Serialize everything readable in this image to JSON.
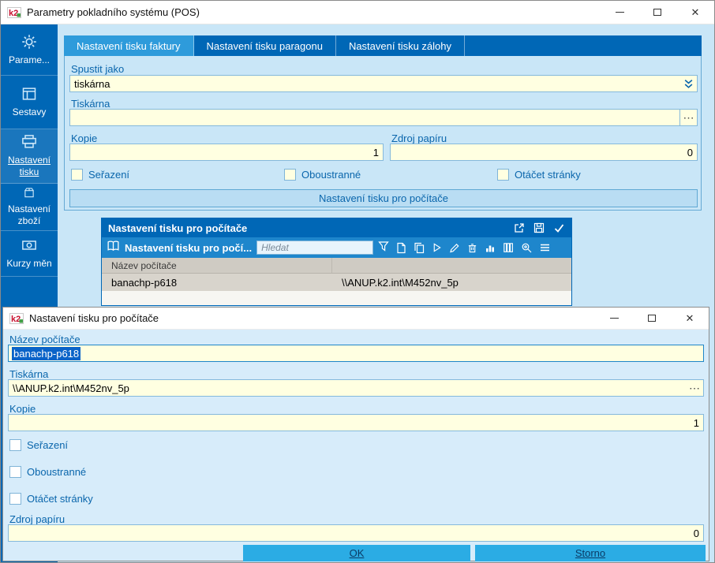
{
  "window": {
    "title": "Parametry pokladního systému (POS)",
    "icon_text": "k2"
  },
  "icons": {
    "close": "✕",
    "ellipsis": "⋯"
  },
  "sidebar": {
    "items": [
      {
        "label": "Parame..."
      },
      {
        "label": "Sestavy"
      },
      {
        "label": "Nastavení tisku",
        "selected": true
      },
      {
        "label": "Nastavení zboží"
      },
      {
        "label": "Kurzy měn"
      }
    ]
  },
  "tabs": [
    {
      "label": "Nastavení tisku faktury",
      "active": true
    },
    {
      "label": "Nastavení tisku paragonu",
      "active": false
    },
    {
      "label": "Nastavení tisku zálohy",
      "active": false
    }
  ],
  "form": {
    "run_as": {
      "label": "Spustit jako",
      "value": "tiskárna"
    },
    "printer": {
      "label": "Tiskárna",
      "value": ""
    },
    "copies": {
      "label": "Kopie",
      "value": "1"
    },
    "paper_source": {
      "label": "Zdroj papíru",
      "value": "0"
    },
    "checkboxes": [
      {
        "label": "Seřazení",
        "checked": false
      },
      {
        "label": "Oboustranné",
        "checked": false
      },
      {
        "label": "Otáčet stránky",
        "checked": false
      }
    ],
    "computers_button": "Nastavení tisku pro počítače"
  },
  "panel": {
    "title": "Nastavení tisku pro počítače",
    "toolbar_title": "Nastavení tisku pro počí...",
    "search_placeholder": "Hledat",
    "table": {
      "columns": [
        "Název počítače"
      ],
      "rows": [
        {
          "computer": "banachp-p618",
          "printer": "\\\\ANUP.k2.int\\M452nv_5p"
        }
      ]
    }
  },
  "dialog": {
    "title": "Nastavení tisku pro počítače",
    "computer_name": {
      "label": "Název počítače",
      "value": "banachp-p618",
      "selected": true
    },
    "printer": {
      "label": "Tiskárna",
      "value": "\\\\ANUP.k2.int\\M452nv_5p"
    },
    "copies": {
      "label": "Kopie",
      "value": "1"
    },
    "checkboxes": [
      {
        "label": "Seřazení",
        "checked": false
      },
      {
        "label": "Oboustranné",
        "checked": false
      },
      {
        "label": "Otáčet stránky",
        "checked": false
      }
    ],
    "paper_source": {
      "label": "Zdroj papíru",
      "value": "0"
    },
    "buttons": {
      "ok": "OK",
      "storno": "Storno"
    }
  },
  "colors": {
    "accent": "#0A66AC",
    "sidebar_bg": "#0067B6",
    "tab_active": "#2E9BDB",
    "toolbar_bg": "#1E86CC",
    "input_bg": "#FFFFE1",
    "content_bg": "#C9E6F7",
    "dialog_bg": "#D7ECFA",
    "button_bg": "#2BACE4",
    "selection_bg": "#0A63C8"
  }
}
